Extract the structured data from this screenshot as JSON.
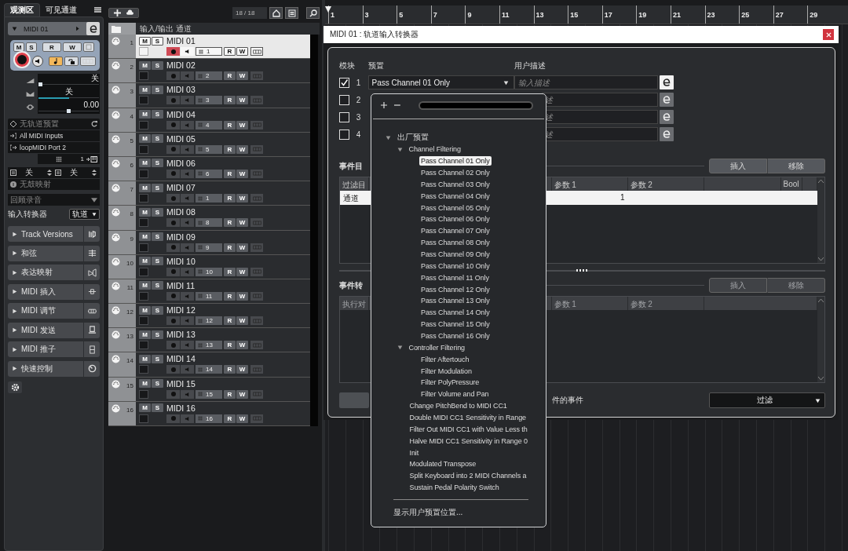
{
  "inspector": {
    "tabs": [
      {
        "label": "观测区",
        "selected": true
      },
      {
        "label": "可见通道",
        "selected": false
      }
    ],
    "track_name": "MIDI 01",
    "controls": {
      "mute": "M",
      "solo": "S",
      "read": "R",
      "write": "W",
      "record": true,
      "note_mode": true
    },
    "faders": [
      {
        "kind": "thumb",
        "value": "关",
        "level": 0
      },
      {
        "kind": "bar",
        "value": "关",
        "level": 0.5
      },
      {
        "kind": "thumb",
        "value": "0.00",
        "level": 0.5
      }
    ],
    "track_preset": "无轨道预置",
    "input": "All MIDI Inputs",
    "output": "loopMIDI Port 2",
    "channel": "1",
    "bank": "关",
    "program": "关",
    "drum_map": "无鼓映射",
    "retrospective_record": "回顾录音",
    "input_transformer": {
      "label": "输入转换器",
      "value": "轨道"
    },
    "sections": [
      {
        "label": "Track Versions",
        "kind": "versions"
      },
      {
        "label": "和弦",
        "kind": "chords"
      },
      {
        "label": "表达映射",
        "kind": "expression"
      },
      {
        "label": "MIDI 插入",
        "kind": "inserts"
      },
      {
        "label": "MIDI 调节",
        "kind": "modifiers"
      },
      {
        "label": "MIDI 发送",
        "kind": "sends"
      },
      {
        "label": "MIDI 推子",
        "kind": "fader"
      },
      {
        "label": "快速控制",
        "kind": "quick"
      }
    ]
  },
  "track_list": {
    "count": "18 / 18",
    "header": "输入/输出 通道",
    "tracks": [
      {
        "number": "1",
        "name": "MIDI 01",
        "channel": "1",
        "record": true,
        "selected": true,
        "mute": "M",
        "solo": "S",
        "read": "R",
        "write": "W"
      },
      {
        "number": "2",
        "name": "MIDI 02",
        "channel": "2",
        "record": false,
        "selected": false,
        "mute": "M",
        "solo": "S",
        "read": "R",
        "write": "W"
      },
      {
        "number": "3",
        "name": "MIDI 03",
        "channel": "3",
        "record": false,
        "selected": false,
        "mute": "M",
        "solo": "S",
        "read": "R",
        "write": "W"
      },
      {
        "number": "4",
        "name": "MIDI 04",
        "channel": "4",
        "record": false,
        "selected": false,
        "mute": "M",
        "solo": "S",
        "read": "R",
        "write": "W"
      },
      {
        "number": "5",
        "name": "MIDI 05",
        "channel": "5",
        "record": false,
        "selected": false,
        "mute": "M",
        "solo": "S",
        "read": "R",
        "write": "W"
      },
      {
        "number": "6",
        "name": "MIDI 06",
        "channel": "6",
        "record": false,
        "selected": false,
        "mute": "M",
        "solo": "S",
        "read": "R",
        "write": "W"
      },
      {
        "number": "7",
        "name": "MIDI 07",
        "channel": "1",
        "record": false,
        "selected": false,
        "mute": "M",
        "solo": "S",
        "read": "R",
        "write": "W"
      },
      {
        "number": "8",
        "name": "MIDI 08",
        "channel": "8",
        "record": false,
        "selected": false,
        "mute": "M",
        "solo": "S",
        "read": "R",
        "write": "W"
      },
      {
        "number": "9",
        "name": "MIDI 09",
        "channel": "9",
        "record": false,
        "selected": false,
        "mute": "M",
        "solo": "S",
        "read": "R",
        "write": "W"
      },
      {
        "number": "10",
        "name": "MIDI 10",
        "channel": "10",
        "record": false,
        "selected": false,
        "mute": "M",
        "solo": "S",
        "read": "R",
        "write": "W"
      },
      {
        "number": "11",
        "name": "MIDI 11",
        "channel": "11",
        "record": false,
        "selected": false,
        "mute": "M",
        "solo": "S",
        "read": "R",
        "write": "W"
      },
      {
        "number": "12",
        "name": "MIDI 12",
        "channel": "12",
        "record": false,
        "selected": false,
        "mute": "M",
        "solo": "S",
        "read": "R",
        "write": "W"
      },
      {
        "number": "13",
        "name": "MIDI 13",
        "channel": "13",
        "record": false,
        "selected": false,
        "mute": "M",
        "solo": "S",
        "read": "R",
        "write": "W"
      },
      {
        "number": "14",
        "name": "MIDI 14",
        "channel": "14",
        "record": false,
        "selected": false,
        "mute": "M",
        "solo": "S",
        "read": "R",
        "write": "W"
      },
      {
        "number": "15",
        "name": "MIDI 15",
        "channel": "15",
        "record": false,
        "selected": false,
        "mute": "M",
        "solo": "S",
        "read": "R",
        "write": "W"
      },
      {
        "number": "16",
        "name": "MIDI 16",
        "channel": "16",
        "record": false,
        "selected": false,
        "mute": "M",
        "solo": "S",
        "read": "R",
        "write": "W"
      }
    ]
  },
  "ruler": [
    "1",
    "3",
    "5",
    "7",
    "9",
    "11",
    "13",
    "15",
    "17",
    "19",
    "21",
    "23",
    "25",
    "27",
    "29"
  ],
  "transformer_dialog": {
    "title": "MIDI 01 : 轨道输入转换器",
    "headers": {
      "module": "模块",
      "preset": "预置",
      "description": "用户描述"
    },
    "modules": [
      {
        "number": "1",
        "checked": true,
        "preset": "Pass Channel 01 Only",
        "placeholder": "输入描述"
      },
      {
        "number": "2",
        "checked": false,
        "placeholder": "述"
      },
      {
        "number": "3",
        "checked": false,
        "placeholder": "述"
      },
      {
        "number": "4",
        "checked": false,
        "placeholder": "述"
      }
    ],
    "filter_section": {
      "label": "事件目",
      "insert": "插入",
      "remove": "移除",
      "disabled": false,
      "headers": [
        "过滤目",
        "参数 1",
        "参数 2",
        "Bool"
      ],
      "rows": [
        {
          "column_1": "通道",
          "param_1": "1"
        }
      ]
    },
    "action_section": {
      "label": "事件转",
      "insert": "插入",
      "remove": "移除",
      "disabled": true,
      "headers": [
        "执行对",
        "参数 1",
        "参数 2"
      ]
    },
    "function_text": "件的事件",
    "function_value": "过滤"
  },
  "preset_popup": {
    "items": [
      {
        "label": "出厂预置",
        "expanded": true,
        "selected": false,
        "children": [
          {
            "label": "Channel Filtering",
            "expanded": true,
            "selected": false,
            "children": [
              {
                "label": "Pass Channel 01 Only",
                "selected": true
              },
              {
                "label": "Pass Channel 02 Only",
                "selected": false
              },
              {
                "label": "Pass Channel 03 Only",
                "selected": false
              },
              {
                "label": "Pass Channel 04 Only",
                "selected": false
              },
              {
                "label": "Pass Channel 05 Only",
                "selected": false
              },
              {
                "label": "Pass Channel 06 Only",
                "selected": false
              },
              {
                "label": "Pass Channel 07 Only",
                "selected": false
              },
              {
                "label": "Pass Channel 08 Only",
                "selected": false
              },
              {
                "label": "Pass Channel 09 Only",
                "selected": false
              },
              {
                "label": "Pass Channel 10 Only",
                "selected": false
              },
              {
                "label": "Pass Channel 11 Only",
                "selected": false
              },
              {
                "label": "Pass Channel 12 Only",
                "selected": false
              },
              {
                "label": "Pass Channel 13 Only",
                "selected": false
              },
              {
                "label": "Pass Channel 14 Only",
                "selected": false
              },
              {
                "label": "Pass Channel 15 Only",
                "selected": false
              },
              {
                "label": "Pass Channel 16 Only",
                "selected": false
              }
            ]
          },
          {
            "label": "Controller Filtering",
            "expanded": true,
            "selected": false,
            "children": [
              {
                "label": "Filter Aftertouch",
                "selected": false
              },
              {
                "label": "Filter Modulation",
                "selected": false
              },
              {
                "label": "Filter PolyPressure",
                "selected": false
              },
              {
                "label": "Filter Volume and Pan",
                "selected": false
              }
            ]
          },
          {
            "label": "Change PitchBend to MIDI CC1",
            "selected": false
          },
          {
            "label": "Double MIDI CC1 Sensitivity in Range",
            "selected": false
          },
          {
            "label": "Filter Out MIDI CC1 with Value Less th",
            "selected": false
          },
          {
            "label": "Halve MIDI CC1 Sensitivity in Range 0",
            "selected": false
          },
          {
            "label": "Init",
            "selected": false
          },
          {
            "label": "Modulated Transpose",
            "selected": false
          },
          {
            "label": "Split Keyboard into 2 MIDI Channels a",
            "selected": false
          },
          {
            "label": "Sustain Pedal Polarity Switch",
            "selected": false
          }
        ]
      }
    ],
    "footer": "显示用户预置位置..."
  }
}
